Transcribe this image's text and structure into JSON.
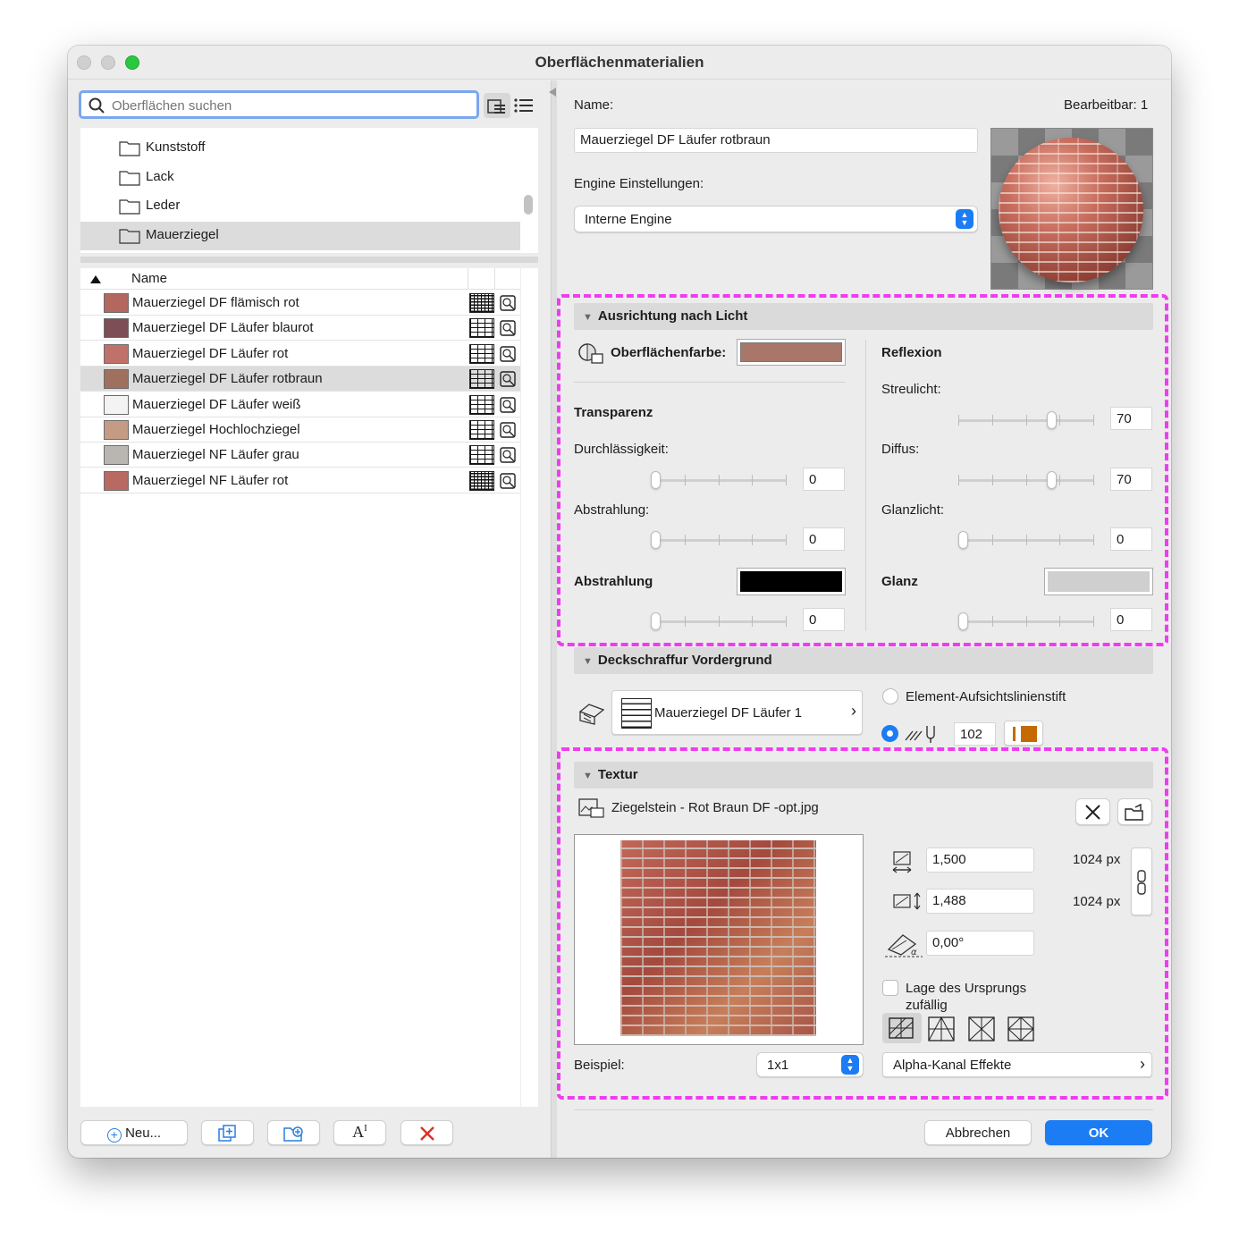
{
  "window": {
    "title": "Oberflächenmaterialien"
  },
  "search": {
    "placeholder": "Oberflächen suchen"
  },
  "folders": [
    "Kunststoff",
    "Lack",
    "Leder",
    "Mauerziegel"
  ],
  "list": {
    "column_name": "Name",
    "items": [
      {
        "name": "Mauerziegel DF flämisch rot",
        "color": "#b4675f"
      },
      {
        "name": "Mauerziegel DF Läufer blaurot",
        "color": "#7d4e56"
      },
      {
        "name": "Mauerziegel DF Läufer rot",
        "color": "#c0726a"
      },
      {
        "name": "Mauerziegel DF Läufer rotbraun",
        "color": "#a0705f"
      },
      {
        "name": "Mauerziegel DF Läufer weiß",
        "color": "#f3f3f3"
      },
      {
        "name": "Mauerziegel Hochlochziegel",
        "color": "#c49c86"
      },
      {
        "name": "Mauerziegel NF Läufer grau",
        "color": "#b9b6b2"
      },
      {
        "name": "Mauerziegel NF Läufer rot",
        "color": "#b86a62"
      }
    ]
  },
  "bottom_buttons": {
    "new": "Neu..."
  },
  "details": {
    "name_label": "Name:",
    "editable": "Bearbeitbar: 1",
    "name_value": "Mauerziegel DF Läufer rotbraun",
    "engine_label": "Engine Einstellungen:",
    "engine_value": "Interne Engine"
  },
  "light": {
    "header": "Ausrichtung nach Licht",
    "surface_color_label": "Oberflächenfarbe:",
    "surface_color": "#a9776a",
    "transparency": "Transparenz",
    "permeability_label": "Durchlässigkeit:",
    "permeability_value": "0",
    "emission_label": "Abstrahlung:",
    "emission_value": "0",
    "emission2_label": "Abstrahlung",
    "emission2_value": "0",
    "emission_color": "#000000",
    "reflection": "Reflexion",
    "ambient_label": "Streulicht:",
    "ambient_value": "70",
    "diffuse_label": "Diffus:",
    "diffuse_value": "70",
    "specular_label": "Glanzlicht:",
    "specular_value": "0",
    "gloss_label": "Glanz",
    "gloss_value": "0",
    "gloss_color": "#cfcfcf"
  },
  "hatch": {
    "header": "Deckschraffur Vordergrund",
    "pattern_name": "Mauerziegel DF Läufer 1",
    "option_label": "Element-Aufsichtslinienstift",
    "pen_number": "102",
    "pen_color": "#c46a00"
  },
  "texture": {
    "header": "Textur",
    "file": "Ziegelstein - Rot Braun DF -opt.jpg",
    "width_value": "1,500",
    "width_px": "1024 px",
    "height_value": "1,488",
    "height_px": "1024 px",
    "angle_value": "0,00°",
    "random_origin_label": "Lage des Ursprungs zufällig",
    "example_label": "Beispiel:",
    "example_value": "1x1",
    "alpha_label": "Alpha-Kanal Effekte"
  },
  "footer": {
    "cancel": "Abbrechen",
    "ok": "OK"
  }
}
